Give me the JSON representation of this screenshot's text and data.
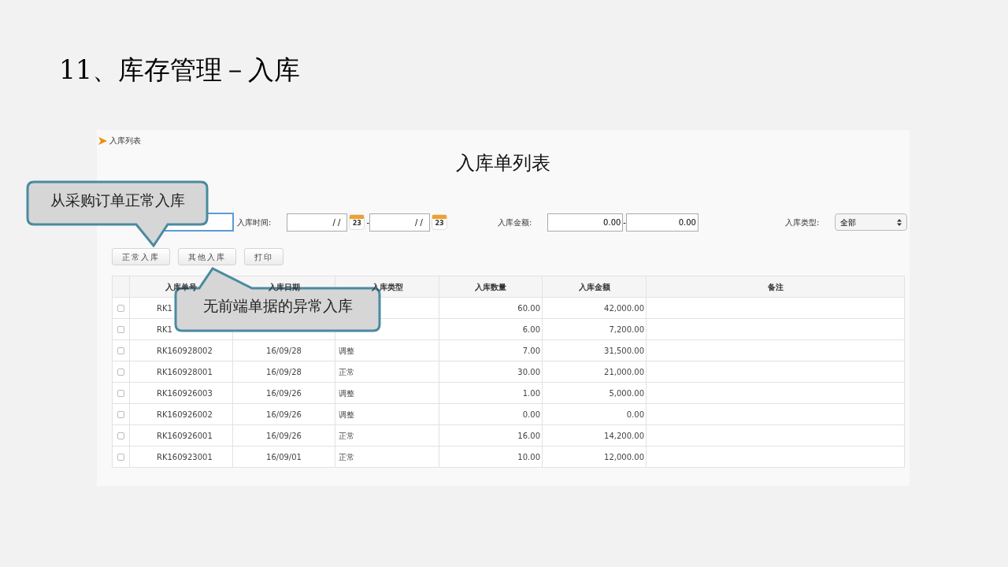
{
  "slide_title": "11、库存管理－入库",
  "panel": {
    "breadcrumb": "入库列表",
    "heading": "入库单列表",
    "filters": [
      {
        "kind": "text",
        "focused": true
      },
      {
        "kind": "date_range",
        "label": "入库时间:",
        "from": "/ /",
        "to": "/ /",
        "separator": "-",
        "from_calendar_day": "23",
        "to_calendar_day": "23"
      },
      {
        "kind": "amount_range",
        "label": "入库金额:",
        "from": "0.00",
        "to": "0.00",
        "separator": "-"
      },
      {
        "kind": "select",
        "label": "入库类型:",
        "value": "全部"
      }
    ],
    "buttons": [
      "正常入库",
      "其他入库",
      "打印"
    ],
    "table": {
      "columns": [
        "入库单号",
        "入库日期",
        "入库类型",
        "入库数量",
        "入库金额",
        "备注"
      ],
      "rows": [
        {
          "checked": false,
          "cells": [
            "RK1",
            "",
            "",
            "60.00",
            "42,000.00",
            ""
          ]
        },
        {
          "checked": false,
          "cells": [
            "RK1",
            "",
            "",
            "6.00",
            "7,200.00",
            ""
          ]
        },
        {
          "checked": false,
          "cells": [
            "RK160928002",
            "16/09/28",
            "调整",
            "7.00",
            "31,500.00",
            ""
          ]
        },
        {
          "checked": false,
          "cells": [
            "RK160928001",
            "16/09/28",
            "正常",
            "30.00",
            "21,000.00",
            ""
          ]
        },
        {
          "checked": false,
          "cells": [
            "RK160926003",
            "16/09/26",
            "调整",
            "1.00",
            "5,000.00",
            ""
          ]
        },
        {
          "checked": false,
          "cells": [
            "RK160926002",
            "16/09/26",
            "调整",
            "0.00",
            "0.00",
            ""
          ]
        },
        {
          "checked": false,
          "cells": [
            "RK160926001",
            "16/09/26",
            "正常",
            "16.00",
            "14,200.00",
            ""
          ]
        },
        {
          "checked": false,
          "cells": [
            "RK160923001",
            "16/09/01",
            "正常",
            "10.00",
            "12,000.00",
            ""
          ]
        }
      ]
    }
  },
  "callouts": [
    {
      "text": "从采购订单正常入库",
      "kind": "below"
    },
    {
      "text": "无前端单据的异常入库",
      "kind": "above"
    }
  ]
}
